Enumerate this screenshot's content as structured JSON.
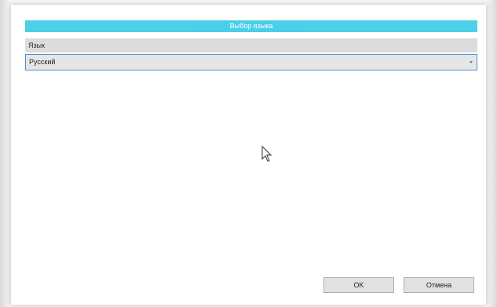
{
  "dialog": {
    "title": "Выбор языка",
    "field_label": "Язык",
    "select_value": "Русский",
    "ok_label": "OK",
    "cancel_label": "Отмена"
  },
  "icons": {
    "dropdown": "chevron-down-icon",
    "cursor": "mouse-pointer-icon"
  },
  "colors": {
    "title_bar": "#42cce6",
    "select_border": "#4a8fd8"
  }
}
